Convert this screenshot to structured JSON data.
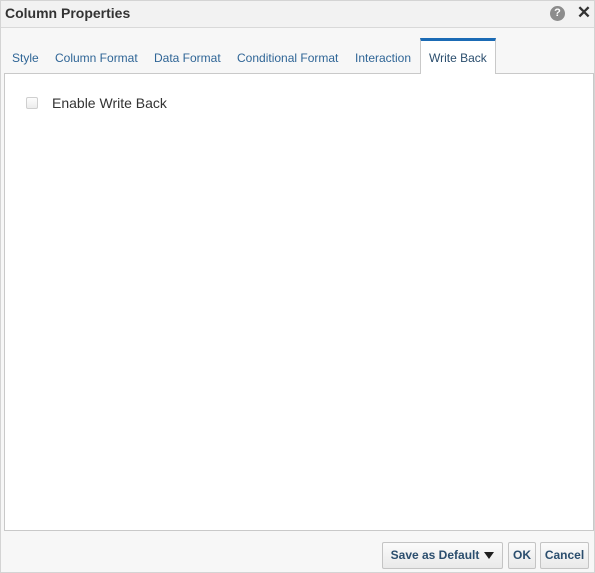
{
  "dialog": {
    "title": "Column Properties",
    "help_icon": "?",
    "close_icon": "✕"
  },
  "tabs": [
    {
      "label": "Style",
      "active": false
    },
    {
      "label": "Column Format",
      "active": false
    },
    {
      "label": "Data Format",
      "active": false
    },
    {
      "label": "Conditional Format",
      "active": false
    },
    {
      "label": "Interaction",
      "active": false
    },
    {
      "label": "Write Back",
      "active": true
    }
  ],
  "write_back": {
    "enable_label": "Enable Write Back",
    "enabled": false
  },
  "footer": {
    "save_default_label": "Save as Default",
    "ok_label": "OK",
    "cancel_label": "Cancel"
  },
  "colors": {
    "accent": "#1b6bb5",
    "tab_text": "#2f6596"
  }
}
